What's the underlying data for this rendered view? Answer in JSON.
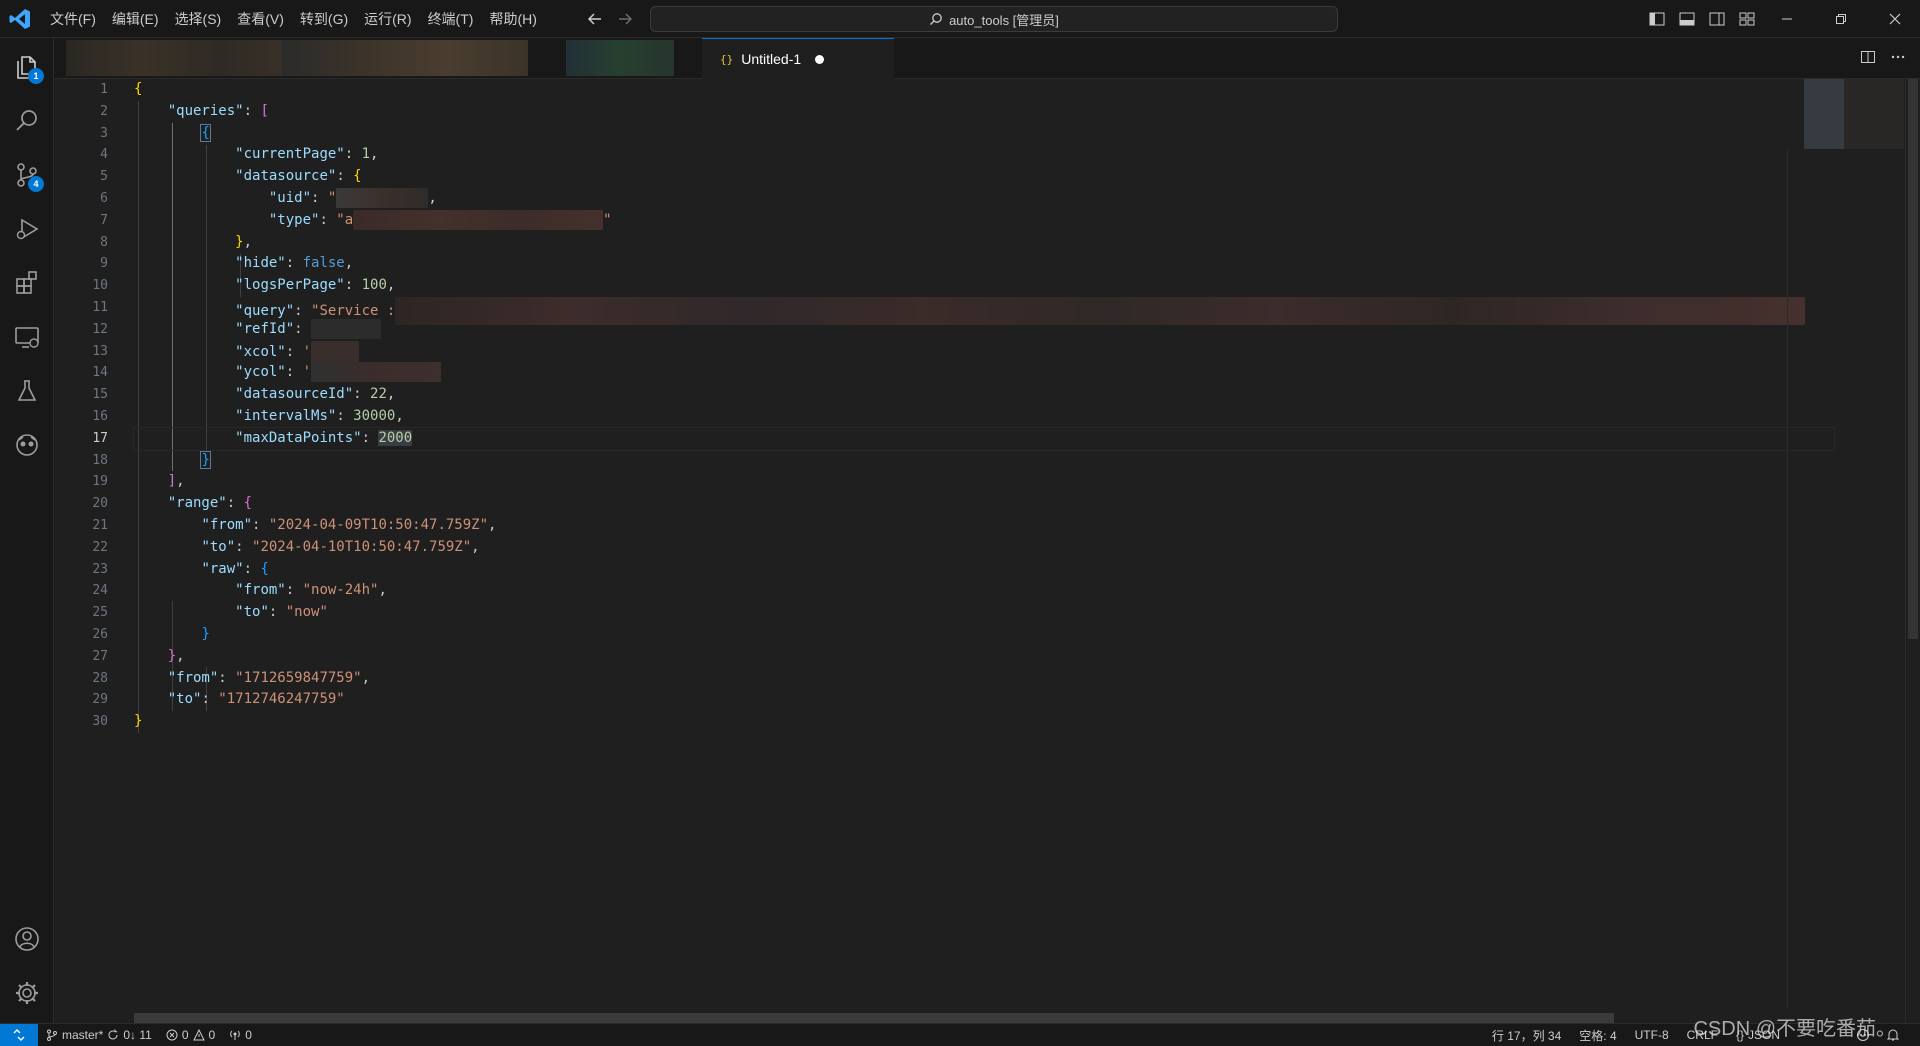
{
  "menu": [
    "文件(F)",
    "编辑(E)",
    "选择(S)",
    "查看(V)",
    "转到(G)",
    "运行(R)",
    "终端(T)",
    "帮助(H)"
  ],
  "command_center": "auto_tools [管理员]",
  "activity_badges": {
    "explorer": "1",
    "source_control": "4"
  },
  "tab": {
    "icon": "{}",
    "label": "Untitled-1"
  },
  "editor": {
    "line_numbers": [
      "1",
      "2",
      "3",
      "4",
      "5",
      "6",
      "7",
      "8",
      "9",
      "10",
      "11",
      "12",
      "13",
      "14",
      "15",
      "16",
      "17",
      "18",
      "19",
      "20",
      "21",
      "22",
      "23",
      "24",
      "25",
      "26",
      "27",
      "28",
      "29",
      "30"
    ],
    "active_line": 17
  },
  "code": {
    "l1_brace": "{",
    "l2_key": "\"queries\"",
    "colon": ": ",
    "comma": ",",
    "open_bracket": "[",
    "close_bracket": "]",
    "open_brace": "{",
    "close_brace": "}",
    "currentPage_key": "\"currentPage\"",
    "currentPage_val": "1",
    "datasource_key": "\"datasource\"",
    "uid_key": "\"uid\"",
    "uid_val_start": "\"",
    "type_key": "\"type\"",
    "type_val_start": "\"a",
    "quote": "\"",
    "hide_key": "\"hide\"",
    "hide_val": "false",
    "logsPerPage_key": "\"logsPerPage\"",
    "logsPerPage_val": "100",
    "query_key": "\"query\"",
    "query_val": "\"Service :",
    "refId_key": "\"refId\"",
    "xcol_key": "\"xcol\"",
    "ycol_key": "\"ycol\"",
    "tick": "'",
    "datasourceId_key": "\"datasourceId\"",
    "datasourceId_val": "22",
    "intervalMs_key": "\"intervalMs\"",
    "intervalMs_val": "30000",
    "maxDataPoints_key": "\"maxDataPoints\"",
    "maxDataPoints_val": "2000",
    "range_key": "\"range\"",
    "from_key": "\"from\"",
    "to_key": "\"to\"",
    "range_from_val": "\"2024-04-09T10:50:47.759Z\"",
    "range_to_val": "\"2024-04-10T10:50:47.759Z\"",
    "raw_key": "\"raw\"",
    "raw_from_val": "\"now-24h\"",
    "raw_to_val": "\"now\"",
    "from_val": "\"1712659847759\"",
    "to_val": "\"1712746247759\""
  },
  "status": {
    "branch": "master*",
    "sync": "0↓ 11",
    "errors": "0",
    "warnings": "0",
    "ports": "0",
    "position": "行 17，列 34",
    "spaces": "空格: 4",
    "encoding": "UTF-8",
    "eol": "CRLF",
    "language_icon": "{}",
    "language": "JSON"
  },
  "watermark": "CSDN @不要吃番茄。",
  "colors": {
    "accent": "#0078d4",
    "string": "#ce9178",
    "key": "#9cdcfe",
    "number": "#b5cea8",
    "keyword": "#569cd6",
    "bracket1": "#ffd700",
    "bracket2": "#da70d6",
    "bracket3": "#179fff"
  }
}
